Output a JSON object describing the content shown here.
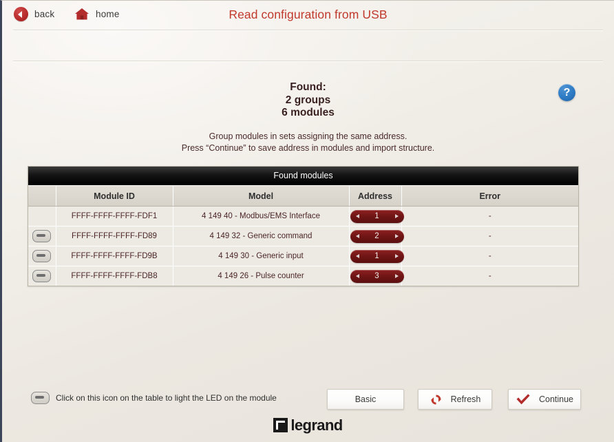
{
  "window": {
    "title": "Read configuration from USB"
  },
  "topbar": {
    "back_label": "back",
    "home_label": "home",
    "back_icon": "back-arrow-circle-icon",
    "home_icon": "home-icon"
  },
  "summary": {
    "found_label": "Found:",
    "groups_line": "2 groups",
    "modules_line": "6 modules",
    "instruction_line_1": "Group modules in sets assigning the same address.",
    "instruction_line_2": "Press “Continue” to save address in modules and import structure.",
    "help_glyph": "?"
  },
  "table": {
    "caption": "Found modules",
    "columns": [
      "",
      "Module ID",
      "Model",
      "Address",
      "Error"
    ],
    "rows": [
      {
        "led": false,
        "module_id": "FFFF-FFFF-FFFF-FDF1",
        "model": "4 149 40 - Modbus/EMS Interface",
        "address": "1",
        "error": "-"
      },
      {
        "led": true,
        "module_id": "FFFF-FFFF-FFFF-FD89",
        "model": "4 149 32 - Generic command",
        "address": "2",
        "error": "-"
      },
      {
        "led": true,
        "module_id": "FFFF-FFFF-FFFF-FD9B",
        "model": "4 149 30 - Generic input",
        "address": "1",
        "error": "-"
      },
      {
        "led": true,
        "module_id": "FFFF-FFFF-FFFF-FDB8",
        "model": "4 149 26 - Pulse counter",
        "address": "3",
        "error": "-"
      }
    ]
  },
  "footer": {
    "hint_text": "Click on this icon on the table to light the LED on the module",
    "basic_label": "Basic",
    "refresh_label": "Refresh",
    "continue_label": "Continue"
  },
  "brand": {
    "name": "legrand"
  },
  "colors": {
    "title_red": "#c0392b",
    "accent_dark_red": "#6d1414",
    "help_blue": "#2f7dc6",
    "table_header_black": "#000000"
  }
}
